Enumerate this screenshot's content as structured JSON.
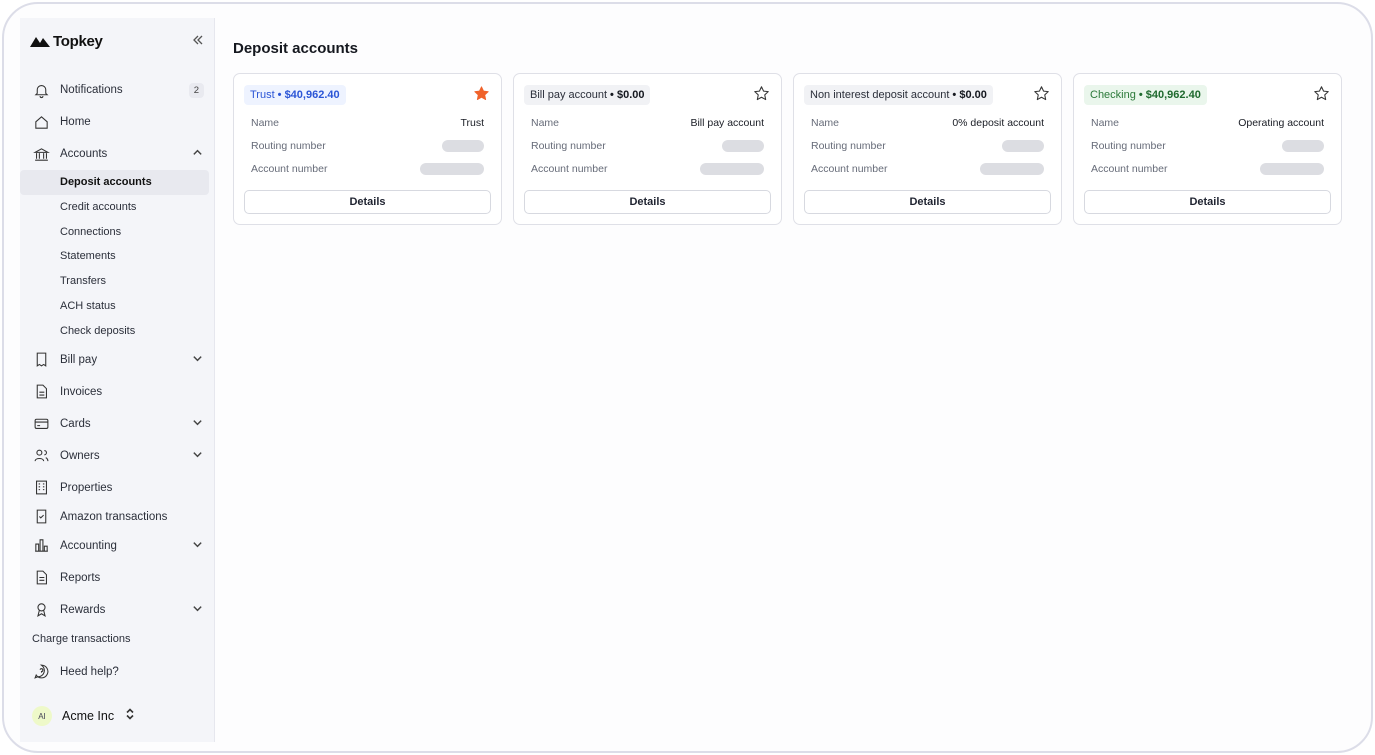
{
  "app": {
    "brand": "Topkey",
    "collapse_icon": "double-chevron-left-icon"
  },
  "sidebar": {
    "notifications": {
      "label": "Notifications",
      "count": "2"
    },
    "home": {
      "label": "Home"
    },
    "accounts": {
      "label": "Accounts",
      "children": [
        "Deposit accounts",
        "Credit accounts",
        "Connections",
        "Statements",
        "Transfers",
        "ACH status",
        "Check deposits"
      ],
      "active": "Deposit accounts"
    },
    "bill_pay": {
      "label": "Bill pay"
    },
    "invoices": {
      "label": "Invoices"
    },
    "cards": {
      "label": "Cards"
    },
    "owners": {
      "label": "Owners"
    },
    "properties": {
      "label": "Properties"
    },
    "amazon": {
      "label": "Amazon transactions"
    },
    "accounting": {
      "label": "Accounting"
    },
    "reports": {
      "label": "Reports"
    },
    "rewards": {
      "label": "Rewards"
    },
    "charge_transactions": {
      "label": "Charge transactions"
    },
    "help": {
      "label": "Heed help?"
    },
    "org": {
      "initials": "AI",
      "name": "Acme Inc"
    }
  },
  "main": {
    "title": "Deposit accounts",
    "field_labels": {
      "name": "Name",
      "routing": "Routing number",
      "account": "Account number"
    },
    "details_label": "Details",
    "cards": [
      {
        "type": "Trust",
        "amount": "$40,962.40",
        "name": "Trust",
        "style": "blue",
        "favorite": true
      },
      {
        "type": "Bill pay account",
        "amount": "$0.00",
        "name": "Bill pay account",
        "style": "gray",
        "favorite": false
      },
      {
        "type": "Non interest deposit account",
        "amount": "$0.00",
        "name": "0% deposit account",
        "style": "gray",
        "favorite": false
      },
      {
        "type": "Checking",
        "amount": "$40,962.40",
        "name": "Operating account",
        "style": "green",
        "favorite": false
      }
    ]
  },
  "colors": {
    "favorite_star": "#f0622a",
    "accent_blue": "#2b55d6",
    "accent_green": "#2c7a3a"
  }
}
